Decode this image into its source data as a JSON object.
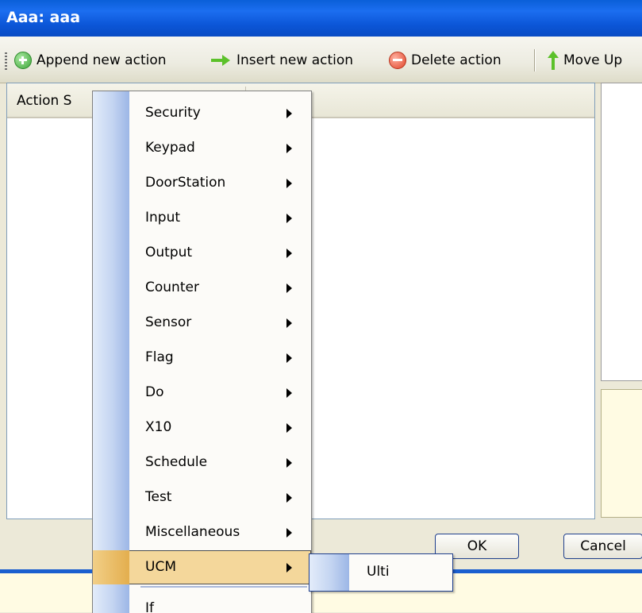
{
  "window": {
    "title": "Aaa: aaa"
  },
  "toolbar": {
    "append_label": "Append new action",
    "insert_label": "Insert new action",
    "delete_label": "Delete action",
    "move_up_label": "Move Up"
  },
  "list": {
    "column_header": "Action S"
  },
  "dialog": {
    "ok_label": "OK",
    "cancel_label": "Cancel"
  },
  "context_menu": {
    "items": [
      {
        "label": "Security",
        "has_submenu": true
      },
      {
        "label": "Keypad",
        "has_submenu": true
      },
      {
        "label": "DoorStation",
        "has_submenu": true
      },
      {
        "label": "Input",
        "has_submenu": true
      },
      {
        "label": "Output",
        "has_submenu": true
      },
      {
        "label": "Counter",
        "has_submenu": true
      },
      {
        "label": "Sensor",
        "has_submenu": true
      },
      {
        "label": "Flag",
        "has_submenu": true
      },
      {
        "label": "Do",
        "has_submenu": true
      },
      {
        "label": "X10",
        "has_submenu": true
      },
      {
        "label": "Schedule",
        "has_submenu": true
      },
      {
        "label": "Test",
        "has_submenu": true
      },
      {
        "label": "Miscellaneous",
        "has_submenu": true
      },
      {
        "label": "UCM",
        "has_submenu": true,
        "selected": true
      },
      {
        "label": "If",
        "has_submenu": false
      }
    ],
    "submenu": {
      "items": [
        {
          "label": "Ulti"
        }
      ]
    }
  },
  "colors": {
    "title_bar": "#0a5fd8",
    "menu_highlight": "#f4d79b",
    "menu_gutter": "#c3d4f1",
    "bottom_panel": "#fffbe3"
  }
}
